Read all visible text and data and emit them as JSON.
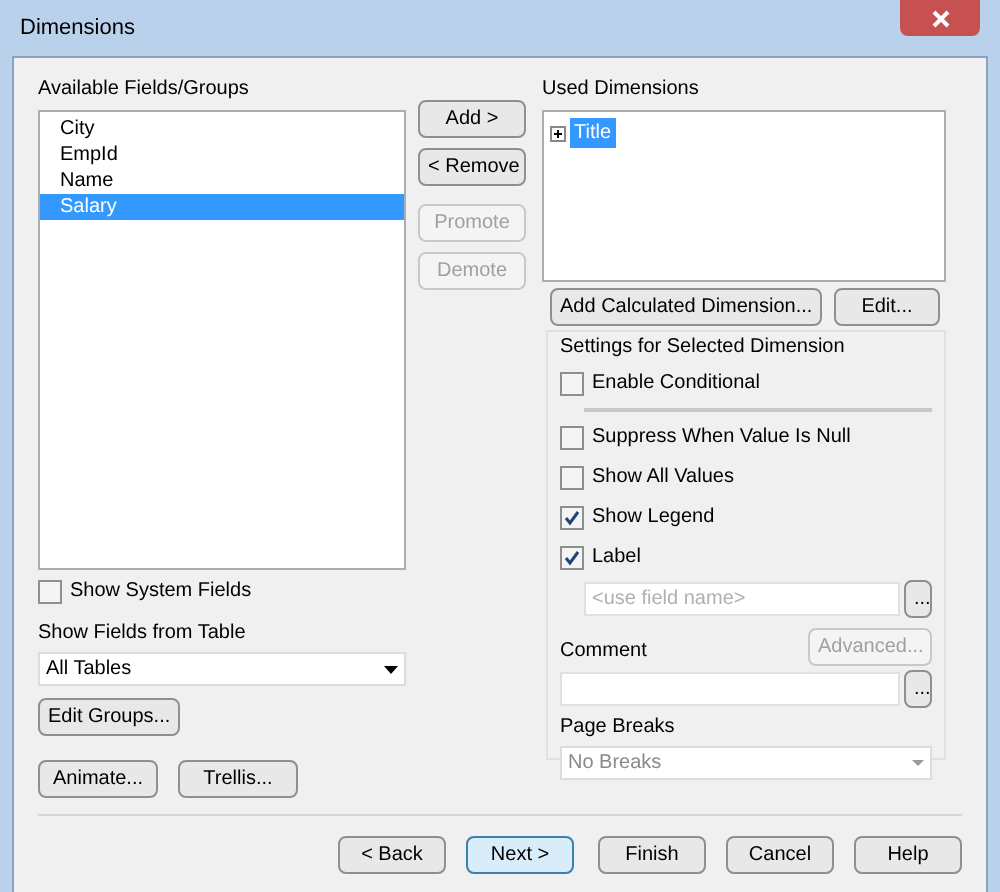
{
  "window": {
    "title": "Dimensions"
  },
  "available": {
    "label": "Available Fields/Groups",
    "items": [
      {
        "label": "City",
        "selected": false
      },
      {
        "label": "EmpId",
        "selected": false
      },
      {
        "label": "Name",
        "selected": false
      },
      {
        "label": "Salary",
        "selected": true
      }
    ]
  },
  "middle_buttons": [
    {
      "label": "Add >",
      "disabled": false
    },
    {
      "label": "< Remove",
      "disabled": false
    },
    {
      "label": "Promote",
      "disabled": true
    },
    {
      "label": "Demote",
      "disabled": true
    }
  ],
  "show_system_fields": {
    "label": "Show System Fields",
    "checked": false
  },
  "table_select": {
    "label": "Show Fields from Table",
    "value": "All Tables"
  },
  "left_buttons": [
    [
      "Edit Groups..."
    ],
    [
      "Animate...",
      "Trellis..."
    ]
  ],
  "used": {
    "label": "Used Dimensions",
    "items": [
      {
        "label": "Title",
        "selected": true,
        "expanded": false
      }
    ]
  },
  "used_buttons": [
    "Add Calculated Dimension...",
    "Edit..."
  ],
  "settings": {
    "title": "Settings for Selected Dimension",
    "enable_conditional": {
      "label": "Enable Conditional",
      "checked": false
    },
    "options": [
      {
        "label": "Suppress When Value Is Null",
        "checked": false
      },
      {
        "label": "Show All Values",
        "checked": false
      },
      {
        "label": "Show Legend",
        "checked": true
      },
      {
        "label": "Label",
        "checked": true
      }
    ],
    "label_field": {
      "placeholder": "<use field name>",
      "button": "..."
    },
    "advanced": {
      "label": "Advanced...",
      "disabled": true
    },
    "comment": {
      "label": "Comment",
      "button": "..."
    },
    "page_breaks": {
      "label": "Page Breaks",
      "value": "No Breaks"
    }
  },
  "footer_buttons": [
    {
      "label": "< Back",
      "hovered": false
    },
    {
      "label": "Next >",
      "hovered": true
    },
    {
      "label": "Finish",
      "hovered": false
    },
    {
      "label": "Cancel",
      "hovered": false
    },
    {
      "label": "Help",
      "hovered": false
    }
  ]
}
